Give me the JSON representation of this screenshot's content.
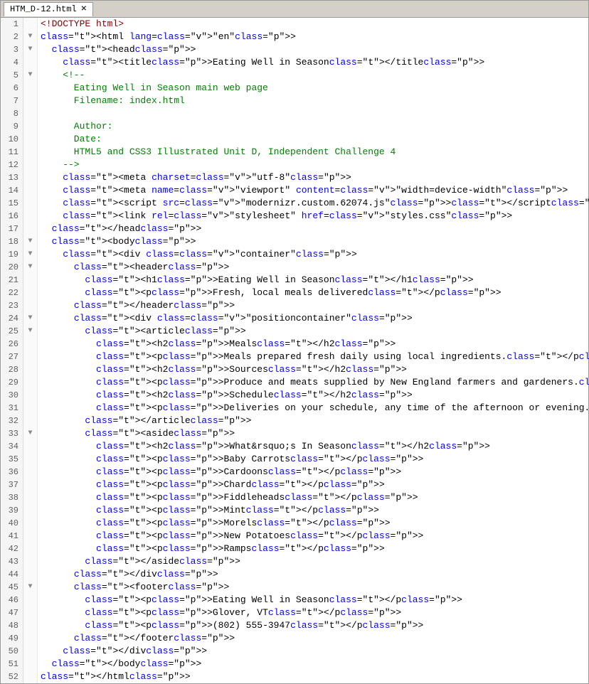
{
  "window": {
    "title": "HTM_D-12.html"
  },
  "lines": [
    {
      "num": 1,
      "indent": 0,
      "gutter": "",
      "code": "<!DOCTYPE html>"
    },
    {
      "num": 2,
      "indent": 0,
      "gutter": "▼",
      "code": "<html lang=\"en\">"
    },
    {
      "num": 3,
      "indent": 1,
      "gutter": "▼",
      "code": "  <head>"
    },
    {
      "num": 4,
      "indent": 2,
      "gutter": "",
      "code": "    <title>Eating Well in Season</title>"
    },
    {
      "num": 5,
      "indent": 2,
      "gutter": "▼",
      "code": "    <!--"
    },
    {
      "num": 6,
      "indent": 3,
      "gutter": "",
      "code": "      Eating Well in Season main web page"
    },
    {
      "num": 7,
      "indent": 3,
      "gutter": "",
      "code": "      Filename: index.html"
    },
    {
      "num": 8,
      "indent": 3,
      "gutter": "",
      "code": ""
    },
    {
      "num": 9,
      "indent": 3,
      "gutter": "",
      "code": "      Author:"
    },
    {
      "num": 10,
      "indent": 3,
      "gutter": "",
      "code": "      Date:"
    },
    {
      "num": 11,
      "indent": 3,
      "gutter": "",
      "code": "      HTML5 and CSS3 Illustrated Unit D, Independent Challenge 4"
    },
    {
      "num": 12,
      "indent": 2,
      "gutter": "",
      "code": "    -->"
    },
    {
      "num": 13,
      "indent": 2,
      "gutter": "",
      "code": "    <meta charset=\"utf-8\">"
    },
    {
      "num": 14,
      "indent": 2,
      "gutter": "",
      "code": "    <meta name=\"viewport\" content=\"width=device-width\">"
    },
    {
      "num": 15,
      "indent": 2,
      "gutter": "",
      "code": "    <script src=\"modernizr.custom.62074.js\"></script>"
    },
    {
      "num": 16,
      "indent": 2,
      "gutter": "",
      "code": "    <link rel=\"stylesheet\" href=\"styles.css\">"
    },
    {
      "num": 17,
      "indent": 1,
      "gutter": "",
      "code": "  </head>"
    },
    {
      "num": 18,
      "indent": 1,
      "gutter": "▼",
      "code": "  <body>"
    },
    {
      "num": 19,
      "indent": 2,
      "gutter": "▼",
      "code": "    <div class=\"container\">"
    },
    {
      "num": 20,
      "indent": 3,
      "gutter": "▼",
      "code": "      <header>"
    },
    {
      "num": 21,
      "indent": 4,
      "gutter": "",
      "code": "        <h1>Eating Well in Season</h1>"
    },
    {
      "num": 22,
      "indent": 4,
      "gutter": "",
      "code": "        <p>Fresh, local meals delivered</p>"
    },
    {
      "num": 23,
      "indent": 3,
      "gutter": "",
      "code": "      </header>"
    },
    {
      "num": 24,
      "indent": 3,
      "gutter": "▼",
      "code": "      <div class=\"positioncontainer\">"
    },
    {
      "num": 25,
      "indent": 4,
      "gutter": "▼",
      "code": "        <article>"
    },
    {
      "num": 26,
      "indent": 5,
      "gutter": "",
      "code": "          <h2>Meals</h2>"
    },
    {
      "num": 27,
      "indent": 5,
      "gutter": "",
      "code": "          <p>Meals prepared fresh daily using local ingredients.</p>"
    },
    {
      "num": 28,
      "indent": 5,
      "gutter": "",
      "code": "          <h2>Sources</h2>"
    },
    {
      "num": 29,
      "indent": 5,
      "gutter": "",
      "code": "          <p>Produce and meats supplied by New England farmers and gardeners.</p>"
    },
    {
      "num": 30,
      "indent": 5,
      "gutter": "",
      "code": "          <h2>Schedule</h2>"
    },
    {
      "num": 31,
      "indent": 5,
      "gutter": "",
      "code": "          <p>Deliveries on your schedule, any time of the afternoon or evening.</p>"
    },
    {
      "num": 32,
      "indent": 4,
      "gutter": "",
      "code": "        </article>"
    },
    {
      "num": 33,
      "indent": 4,
      "gutter": "▼",
      "code": "        <aside>"
    },
    {
      "num": 34,
      "indent": 5,
      "gutter": "",
      "code": "          <h2>What&rsquo;s In Season</h2>"
    },
    {
      "num": 35,
      "indent": 5,
      "gutter": "",
      "code": "          <p>Baby Carrots</p>"
    },
    {
      "num": 36,
      "indent": 5,
      "gutter": "",
      "code": "          <p>Cardoons</p>"
    },
    {
      "num": 37,
      "indent": 5,
      "gutter": "",
      "code": "          <p>Chard</p>"
    },
    {
      "num": 38,
      "indent": 5,
      "gutter": "",
      "code": "          <p>Fiddleheads</p>"
    },
    {
      "num": 39,
      "indent": 5,
      "gutter": "",
      "code": "          <p>Mint</p>"
    },
    {
      "num": 40,
      "indent": 5,
      "gutter": "",
      "code": "          <p>Morels</p>"
    },
    {
      "num": 41,
      "indent": 5,
      "gutter": "",
      "code": "          <p>New Potatoes</p>"
    },
    {
      "num": 42,
      "indent": 5,
      "gutter": "",
      "code": "          <p>Ramps</p>"
    },
    {
      "num": 43,
      "indent": 4,
      "gutter": "",
      "code": "        </aside>"
    },
    {
      "num": 44,
      "indent": 3,
      "gutter": "",
      "code": "      </div>"
    },
    {
      "num": 45,
      "indent": 3,
      "gutter": "▼",
      "code": "      <footer>"
    },
    {
      "num": 46,
      "indent": 4,
      "gutter": "",
      "code": "        <p>Eating Well in Season</p>"
    },
    {
      "num": 47,
      "indent": 4,
      "gutter": "",
      "code": "        <p>Glover, VT</p>"
    },
    {
      "num": 48,
      "indent": 4,
      "gutter": "",
      "code": "        <p>(802) 555-3947</p>"
    },
    {
      "num": 49,
      "indent": 3,
      "gutter": "",
      "code": "      </footer>"
    },
    {
      "num": 50,
      "indent": 2,
      "gutter": "",
      "code": "    </div>"
    },
    {
      "num": 51,
      "indent": 1,
      "gutter": "",
      "code": "  </body>"
    },
    {
      "num": 52,
      "indent": 0,
      "gutter": "",
      "code": "</html>"
    }
  ]
}
